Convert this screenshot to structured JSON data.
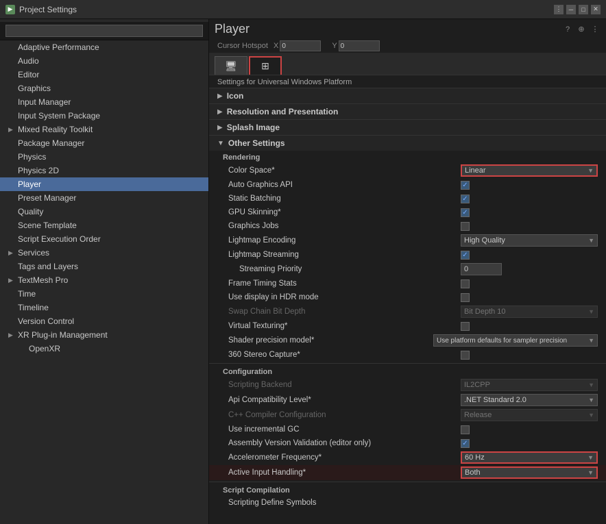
{
  "titleBar": {
    "title": "Project Settings",
    "icon": "▶"
  },
  "search": {
    "placeholder": ""
  },
  "sidebar": {
    "items": [
      {
        "id": "adaptive-performance",
        "label": "Adaptive Performance",
        "indent": false,
        "arrow": false
      },
      {
        "id": "audio",
        "label": "Audio",
        "indent": false,
        "arrow": false
      },
      {
        "id": "editor",
        "label": "Editor",
        "indent": false,
        "arrow": false
      },
      {
        "id": "graphics",
        "label": "Graphics",
        "indent": false,
        "arrow": false
      },
      {
        "id": "input-manager",
        "label": "Input Manager",
        "indent": false,
        "arrow": false
      },
      {
        "id": "input-system-package",
        "label": "Input System Package",
        "indent": false,
        "arrow": false
      },
      {
        "id": "mixed-reality-toolkit",
        "label": "Mixed Reality Toolkit",
        "indent": false,
        "arrow": true
      },
      {
        "id": "package-manager",
        "label": "Package Manager",
        "indent": false,
        "arrow": false
      },
      {
        "id": "physics",
        "label": "Physics",
        "indent": false,
        "arrow": false
      },
      {
        "id": "physics-2d",
        "label": "Physics 2D",
        "indent": false,
        "arrow": false
      },
      {
        "id": "player",
        "label": "Player",
        "indent": false,
        "arrow": false,
        "active": true
      },
      {
        "id": "preset-manager",
        "label": "Preset Manager",
        "indent": false,
        "arrow": false
      },
      {
        "id": "quality",
        "label": "Quality",
        "indent": false,
        "arrow": false
      },
      {
        "id": "scene-template",
        "label": "Scene Template",
        "indent": false,
        "arrow": false
      },
      {
        "id": "script-execution-order",
        "label": "Script Execution Order",
        "indent": false,
        "arrow": false
      },
      {
        "id": "services",
        "label": "Services",
        "indent": false,
        "arrow": true
      },
      {
        "id": "tags-and-layers",
        "label": "Tags and Layers",
        "indent": false,
        "arrow": false
      },
      {
        "id": "textmesh-pro",
        "label": "TextMesh Pro",
        "indent": false,
        "arrow": true
      },
      {
        "id": "time",
        "label": "Time",
        "indent": false,
        "arrow": false
      },
      {
        "id": "timeline",
        "label": "Timeline",
        "indent": false,
        "arrow": false
      },
      {
        "id": "version-control",
        "label": "Version Control",
        "indent": false,
        "arrow": false
      },
      {
        "id": "xr-plugin-management",
        "label": "XR Plug-in Management",
        "indent": false,
        "arrow": true
      },
      {
        "id": "openxr",
        "label": "OpenXR",
        "indent": true,
        "arrow": false
      }
    ]
  },
  "panel": {
    "title": "Player",
    "cursor_hotspot_label": "Cursor Hotspot",
    "cursor_x_label": "X",
    "cursor_x_value": "0",
    "cursor_y_label": "Y",
    "cursor_y_value": "0",
    "platform_label": "Settings for Universal Windows Platform",
    "tabs": [
      {
        "id": "monitor",
        "icon": "🖥",
        "label": "PC"
      },
      {
        "id": "windows",
        "icon": "⊞",
        "label": "Win",
        "active": true
      }
    ],
    "sections": {
      "icon": {
        "label": "Icon",
        "collapsed": true
      },
      "resolution": {
        "label": "Resolution and Presentation",
        "collapsed": true
      },
      "splash": {
        "label": "Splash Image",
        "collapsed": true
      },
      "other": {
        "label": "Other Settings",
        "collapsed": false,
        "sub_sections": {
          "rendering": {
            "label": "Rendering",
            "settings": [
              {
                "id": "color-space",
                "label": "Color Space*",
                "type": "dropdown",
                "value": "Linear",
                "disabled": false,
                "highlighted": true
              },
              {
                "id": "auto-graphics-api",
                "label": "Auto Graphics API",
                "type": "checkbox",
                "checked": true
              },
              {
                "id": "static-batching",
                "label": "Static Batching",
                "type": "checkbox",
                "checked": true
              },
              {
                "id": "gpu-skinning",
                "label": "GPU Skinning*",
                "type": "checkbox",
                "checked": true
              },
              {
                "id": "graphics-jobs",
                "label": "Graphics Jobs",
                "type": "checkbox",
                "checked": false
              },
              {
                "id": "lightmap-encoding",
                "label": "Lightmap Encoding",
                "type": "dropdown",
                "value": "High Quality"
              },
              {
                "id": "lightmap-streaming",
                "label": "Lightmap Streaming",
                "type": "checkbox",
                "checked": true
              },
              {
                "id": "streaming-priority",
                "label": "Streaming Priority",
                "type": "input",
                "value": "0",
                "indented": true
              },
              {
                "id": "frame-timing-stats",
                "label": "Frame Timing Stats",
                "type": "checkbox",
                "checked": false
              },
              {
                "id": "use-display-hdr",
                "label": "Use display in HDR mode",
                "type": "checkbox",
                "checked": false
              },
              {
                "id": "swap-chain-bit-depth",
                "label": "Swap Chain Bit Depth",
                "type": "dropdown",
                "value": "Bit Depth 10",
                "disabled": true
              },
              {
                "id": "virtual-texturing",
                "label": "Virtual Texturing*",
                "type": "checkbox",
                "checked": false
              },
              {
                "id": "shader-precision-model",
                "label": "Shader precision model*",
                "type": "dropdown",
                "value": "Use platform defaults for sampler precision"
              },
              {
                "id": "360-stereo-capture",
                "label": "360 Stereo Capture*",
                "type": "checkbox",
                "checked": false
              }
            ]
          },
          "configuration": {
            "label": "Configuration",
            "settings": [
              {
                "id": "scripting-backend",
                "label": "Scripting Backend",
                "type": "dropdown",
                "value": "IL2CPP",
                "disabled": true
              },
              {
                "id": "api-compatibility-level",
                "label": "Api Compatibility Level*",
                "type": "dropdown",
                "value": ".NET Standard 2.0"
              },
              {
                "id": "cpp-compiler-config",
                "label": "C++ Compiler Configuration",
                "type": "dropdown",
                "value": "Release",
                "disabled": true
              },
              {
                "id": "use-incremental-gc",
                "label": "Use incremental GC",
                "type": "checkbox",
                "checked": false
              },
              {
                "id": "assembly-version-validation",
                "label": "Assembly Version Validation (editor only)",
                "type": "checkbox",
                "checked": true
              },
              {
                "id": "accelerometer-frequency",
                "label": "Accelerometer Frequency*",
                "type": "dropdown",
                "value": "60 Hz",
                "highlighted": true
              },
              {
                "id": "active-input-handling",
                "label": "Active Input Handling*",
                "type": "dropdown",
                "value": "Both",
                "highlighted": true
              }
            ]
          },
          "script-compilation": {
            "label": "Script Compilation",
            "settings": [
              {
                "id": "scripting-define-symbols",
                "label": "Scripting Define Symbols",
                "type": "text",
                "value": ""
              }
            ]
          }
        }
      }
    }
  }
}
